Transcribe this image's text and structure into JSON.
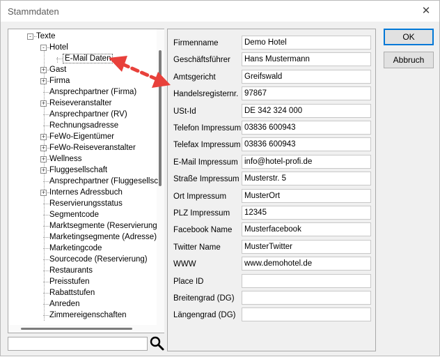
{
  "window": {
    "title": "Stammdaten",
    "close_glyph": "✕"
  },
  "tree": {
    "nodes": [
      {
        "label": "Texte",
        "level": 1,
        "expander": "-"
      },
      {
        "label": "Hotel",
        "level": 2,
        "expander": "-"
      },
      {
        "label": "E-Mail Daten",
        "level": 3,
        "expander": "",
        "selected": true
      },
      {
        "label": "Gast",
        "level": 2,
        "expander": "+"
      },
      {
        "label": "Firma",
        "level": 2,
        "expander": "+"
      },
      {
        "label": "Ansprechpartner (Firma)",
        "level": 2,
        "expander": ""
      },
      {
        "label": "Reiseveranstalter",
        "level": 2,
        "expander": "+"
      },
      {
        "label": "Ansprechpartner (RV)",
        "level": 2,
        "expander": ""
      },
      {
        "label": "Rechnungsadresse",
        "level": 2,
        "expander": ""
      },
      {
        "label": "FeWo-Eigentümer",
        "level": 2,
        "expander": "+"
      },
      {
        "label": "FeWo-Reiseveranstalter",
        "level": 2,
        "expander": "+"
      },
      {
        "label": "Wellness",
        "level": 2,
        "expander": "+"
      },
      {
        "label": "Fluggesellschaft",
        "level": 2,
        "expander": "+"
      },
      {
        "label": "Ansprechpartner (Fluggesellsc",
        "level": 2,
        "expander": ""
      },
      {
        "label": "Internes Adressbuch",
        "level": 2,
        "expander": "+"
      },
      {
        "label": "Reservierungsstatus",
        "level": 2,
        "expander": ""
      },
      {
        "label": "Segmentcode",
        "level": 2,
        "expander": ""
      },
      {
        "label": "Marktsegmente (Reservierung",
        "level": 2,
        "expander": ""
      },
      {
        "label": "Marketingsegmente (Adresse)",
        "level": 2,
        "expander": ""
      },
      {
        "label": "Marketingcode",
        "level": 2,
        "expander": ""
      },
      {
        "label": "Sourcecode (Reservierung)",
        "level": 2,
        "expander": ""
      },
      {
        "label": "Restaurants",
        "level": 2,
        "expander": ""
      },
      {
        "label": "Preisstufen",
        "level": 2,
        "expander": ""
      },
      {
        "label": "Rabattstufen",
        "level": 2,
        "expander": ""
      },
      {
        "label": "Anreden",
        "level": 2,
        "expander": ""
      },
      {
        "label": "Zimmereigenschaften",
        "level": 2,
        "expander": ""
      }
    ],
    "search_value": ""
  },
  "form": {
    "fields": [
      {
        "label": "Firmenname",
        "value": "Demo Hotel"
      },
      {
        "label": "Geschäftsführer",
        "value": "Hans Mustermann"
      },
      {
        "label": "Amtsgericht",
        "value": "Greifswald"
      },
      {
        "label": "Handelsregisternr.",
        "value": "97867"
      },
      {
        "label": "USt-Id",
        "value": "DE 342 324 000"
      },
      {
        "label": "Telefon Impressum",
        "value": "03836 600943"
      },
      {
        "label": "Telefax Impressum",
        "value": "03836 600943"
      },
      {
        "label": "E-Mail Impressum",
        "value": "info@hotel-profi.de"
      },
      {
        "label": "Straße Impressum",
        "value": "Musterstr. 5"
      },
      {
        "label": "Ort Impressum",
        "value": "MusterOrt"
      },
      {
        "label": "PLZ Impressum",
        "value": "12345"
      },
      {
        "label": "Facebook Name",
        "value": "Musterfacebook"
      },
      {
        "label": "Twitter Name",
        "value": "MusterTwitter"
      },
      {
        "label": "WWW",
        "value": "www.demohotel.de"
      },
      {
        "label": "Place ID",
        "value": ""
      },
      {
        "label": "Breitengrad (DG)",
        "value": ""
      },
      {
        "label": "Längengrad (DG)",
        "value": ""
      }
    ]
  },
  "buttons": {
    "ok_label": "OK",
    "cancel_label": "Abbruch"
  },
  "annotation": {
    "arrow_color": "#e8413b"
  }
}
